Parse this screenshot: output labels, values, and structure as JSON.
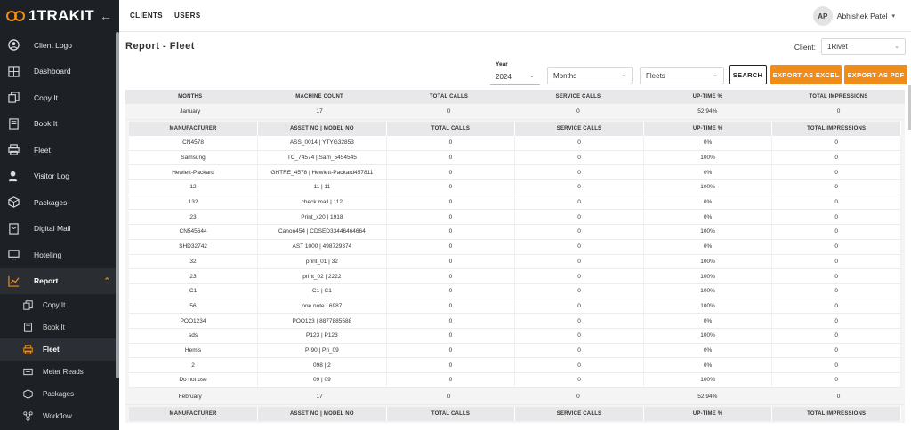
{
  "brand": {
    "name": "1TRAKIT"
  },
  "sidebar": {
    "items": [
      {
        "label": "Client Logo",
        "icon": "client-logo-icon"
      },
      {
        "label": "Dashboard",
        "icon": "dashboard-icon"
      },
      {
        "label": "Copy It",
        "icon": "copy-icon"
      },
      {
        "label": "Book It",
        "icon": "book-icon"
      },
      {
        "label": "Fleet",
        "icon": "printer-icon"
      },
      {
        "label": "Visitor Log",
        "icon": "visitor-icon"
      },
      {
        "label": "Packages",
        "icon": "package-icon"
      },
      {
        "label": "Digital Mail",
        "icon": "mail-icon"
      },
      {
        "label": "Hoteling",
        "icon": "monitor-icon"
      },
      {
        "label": "Report",
        "icon": "chart-icon"
      }
    ],
    "report_sub": [
      {
        "label": "Copy It"
      },
      {
        "label": "Book It"
      },
      {
        "label": "Fleet"
      },
      {
        "label": "Meter Reads"
      },
      {
        "label": "Packages"
      },
      {
        "label": "Workflow"
      }
    ]
  },
  "topbar": {
    "tab_clients": "CLIENTS",
    "tab_users": "USERS",
    "user_initials": "AP",
    "user_name": "Abhishek Patel"
  },
  "page": {
    "title": "Report - Fleet",
    "client_label": "Client:",
    "client_value": "1Rivet",
    "year_label": "Year",
    "year_value": "2024",
    "months_placeholder": "Months",
    "fleets_placeholder": "Fleets",
    "search_label": "SEARCH",
    "export_excel_label": "EXPORT AS EXCEL",
    "export_pdf_label": "EXPORT AS PDF"
  },
  "summary_headers": [
    "MONTHS",
    "MACHINE COUNT",
    "TOTAL CALLS",
    "SERVICE CALLS",
    "UP-TIME %",
    "TOTAL IMPRESSIONS"
  ],
  "detail_headers": [
    "MANUFACTURER",
    "ASSET NO | MODEL NO",
    "TOTAL CALLS",
    "SERVICE CALLS",
    "UP-TIME %",
    "TOTAL IMPRESSIONS"
  ],
  "january": {
    "month": "January",
    "machine_count": "17",
    "total_calls": "0",
    "service_calls": "0",
    "uptime": "52.94%",
    "impressions": "0"
  },
  "january_rows": [
    [
      "CN4578",
      "ASS_0014 | YTYG32853",
      "0",
      "0",
      "0%",
      "0"
    ],
    [
      "Samsung",
      "TC_74574 | Sam_5454545",
      "0",
      "0",
      "100%",
      "0"
    ],
    [
      "Hewlett-Packard",
      "GHTRE_4578 | Hewlett-Packard457811",
      "0",
      "0",
      "0%",
      "0"
    ],
    [
      "12",
      "11 | 11",
      "0",
      "0",
      "100%",
      "0"
    ],
    [
      "132",
      "check mail | 112",
      "0",
      "0",
      "0%",
      "0"
    ],
    [
      "23",
      "Print_x20 | 1918",
      "0",
      "0",
      "0%",
      "0"
    ],
    [
      "CN545644",
      "Canon454 | CDSED33446464664",
      "0",
      "0",
      "100%",
      "0"
    ],
    [
      "SHD32742",
      "AST 1000 | 498729374",
      "0",
      "0",
      "0%",
      "0"
    ],
    [
      "32",
      "print_01 | 32",
      "0",
      "0",
      "100%",
      "0"
    ],
    [
      "23",
      "print_02 | 2222",
      "0",
      "0",
      "100%",
      "0"
    ],
    [
      "C1",
      "C1 | C1",
      "0",
      "0",
      "100%",
      "0"
    ],
    [
      "56",
      "one note | 6987",
      "0",
      "0",
      "100%",
      "0"
    ],
    [
      "POO1234",
      "POO123 | 8877885588",
      "0",
      "0",
      "0%",
      "0"
    ],
    [
      "sds",
      "P123 | P123",
      "0",
      "0",
      "100%",
      "0"
    ],
    [
      "Hem's",
      "P-90 | Pri_09",
      "0",
      "0",
      "0%",
      "0"
    ],
    [
      "2",
      "098 | 2",
      "0",
      "0",
      "0%",
      "0"
    ],
    [
      "Do not use",
      "09 | 09",
      "0",
      "0",
      "100%",
      "0"
    ]
  ],
  "february": {
    "month": "February",
    "machine_count": "17",
    "total_calls": "0",
    "service_calls": "0",
    "uptime": "52.94%",
    "impressions": "0"
  }
}
